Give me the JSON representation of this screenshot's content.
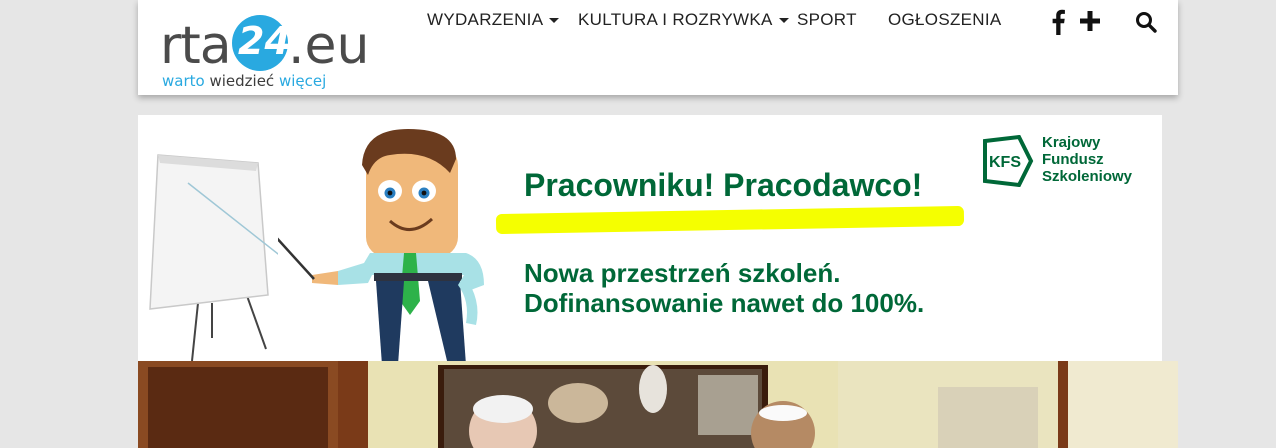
{
  "logo": {
    "main_prefix": "rta",
    "main_number": "24",
    "main_suffix": ".eu",
    "tagline_a": "warto",
    "tagline_b": "wiedzieć",
    "tagline_c": "więcej"
  },
  "nav": {
    "items": [
      {
        "label": "WYDARZENIA",
        "dropdown": true
      },
      {
        "label": "KULTURA I ROZRYWKA",
        "dropdown": true
      },
      {
        "label": "SPORT",
        "dropdown": false
      },
      {
        "label": "OGŁOSZENIA",
        "dropdown": false
      }
    ],
    "icons": [
      "facebook-icon",
      "plus-icon",
      "search-icon"
    ]
  },
  "banner": {
    "headline": "Pracowniku! Pracodawco!",
    "line1": "Nowa przestrzeń szkoleń.",
    "line2": "Dofinansowanie nawet do 100%.",
    "badge_abbr": "KFS",
    "org_line1": "Krajowy",
    "org_line2": "Fundusz",
    "org_line3": "Szkoleniowy"
  },
  "colors": {
    "brand_blue": "#29a9e0",
    "banner_green": "#006838",
    "highlight_yellow": "#f5ff00",
    "page_bg": "#e6e6e6"
  }
}
